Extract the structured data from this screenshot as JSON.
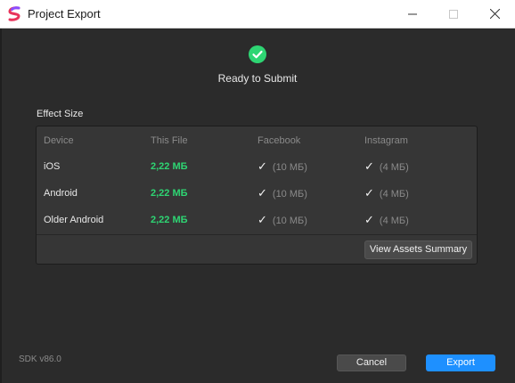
{
  "window": {
    "title": "Project Export",
    "minimize_icon": "minimize-icon",
    "maximize_icon": "maximize-icon",
    "close_icon": "close-icon",
    "app_icon": "spark-logo-icon"
  },
  "status": {
    "icon": "check-circle-icon",
    "text": "Ready to Submit",
    "color": "#2ed573"
  },
  "effect_size": {
    "title": "Effect Size",
    "columns": [
      "Device",
      "This File",
      "Facebook",
      "Instagram"
    ],
    "rows": [
      {
        "device": "iOS",
        "this_file": "2,22 МБ",
        "facebook_check": "✓",
        "facebook_limit": "(10 МБ)",
        "instagram_check": "✓",
        "instagram_limit": "(4 МБ)"
      },
      {
        "device": "Android",
        "this_file": "2,22 МБ",
        "facebook_check": "✓",
        "facebook_limit": "(10 МБ)",
        "instagram_check": "✓",
        "instagram_limit": "(4 МБ)"
      },
      {
        "device": "Older Android",
        "this_file": "2,22 МБ",
        "facebook_check": "✓",
        "facebook_limit": "(10 МБ)",
        "instagram_check": "✓",
        "instagram_limit": "(4 МБ)"
      }
    ],
    "summary_button": "View Assets Summary"
  },
  "footer": {
    "sdk_version": "SDK v86.0",
    "cancel_label": "Cancel",
    "export_label": "Export",
    "accent_color": "#1e90ff"
  }
}
